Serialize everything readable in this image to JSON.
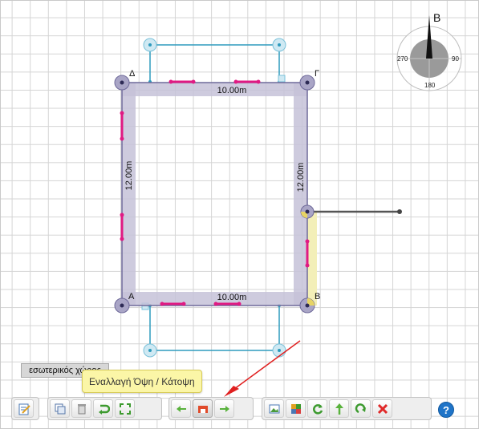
{
  "compass": {
    "north_label": "Β",
    "angle_west": "270",
    "angle_east": "90",
    "angle_south": "180"
  },
  "corners": {
    "nw": "Δ",
    "ne": "Γ",
    "se": "Β",
    "sw": "Α"
  },
  "walls": {
    "top_length": "10.00m",
    "bottom_length": "10.00m",
    "left_length": "12.00m",
    "right_length": "12.00m"
  },
  "space_label": "εσωτερικός χώρος",
  "tooltip": "Εναλλαγή Όψη / Κάτοψη",
  "toolbar": {
    "edit_icon": "edit-document-icon",
    "copy_icon": "copy-icon",
    "delete_icon": "trash-icon",
    "rotate_icon": "green-rotate-icon",
    "fit_icon": "fit-screen-icon",
    "prev_icon": "arrow-left-icon",
    "toggle_icon": "plan-view-icon",
    "next_icon": "arrow-right-icon",
    "image_icon": "image-icon",
    "texture_icon": "texture-icon",
    "refresh_icon": "refresh-icon",
    "up_icon": "arrow-up-icon",
    "redo_icon": "redo-icon",
    "close_icon": "close-x-icon",
    "help_label": "?"
  },
  "colors": {
    "wall_fill": "#c5c2d8",
    "wall_stroke": "#6f6a9a",
    "opening_accent": "#e01a83",
    "balcony": "#2e9bbd",
    "node": "#a9a5c6",
    "highlight": "#f3efb8",
    "arrow": "#e02020"
  }
}
